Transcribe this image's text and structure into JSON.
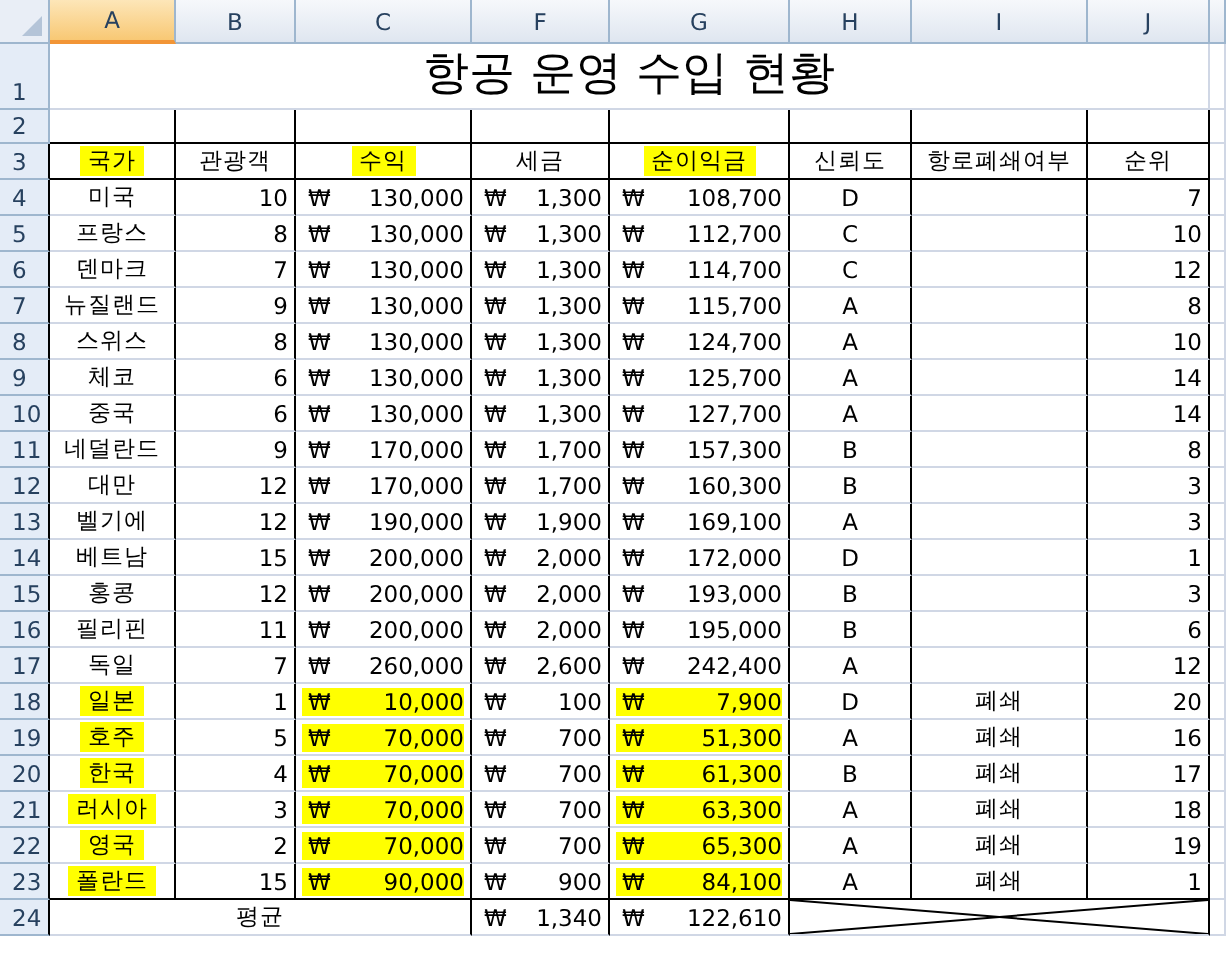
{
  "column_headers": [
    {
      "label": "A",
      "selected": true
    },
    {
      "label": "B",
      "selected": false
    },
    {
      "label": "C",
      "selected": false
    },
    {
      "label": "F",
      "selected": false
    },
    {
      "label": "G",
      "selected": false
    },
    {
      "label": "H",
      "selected": false
    },
    {
      "label": "I",
      "selected": false
    },
    {
      "label": "J",
      "selected": false
    }
  ],
  "title": {
    "row_number": "1",
    "text": "항공 운영 수입 현황"
  },
  "blank_row": {
    "row_number": "2"
  },
  "header_row": {
    "row_number": "3",
    "cells": [
      {
        "label": "국가",
        "highlighted": true
      },
      {
        "label": "관광객",
        "highlighted": false
      },
      {
        "label": "수익",
        "highlighted": true
      },
      {
        "label": "세금",
        "highlighted": false
      },
      {
        "label": "순이익금",
        "highlighted": true
      },
      {
        "label": "신뢰도",
        "highlighted": false
      },
      {
        "label": "항로폐쇄여부",
        "highlighted": false
      },
      {
        "label": "순위",
        "highlighted": false
      }
    ]
  },
  "rows": [
    {
      "row_number": "4",
      "country": "미국",
      "tourists": "10",
      "revenue": [
        "₩",
        "130,000"
      ],
      "tax": [
        "₩",
        "1,300"
      ],
      "net_income": [
        "₩",
        "108,700"
      ],
      "reliability": "D",
      "rank": "7",
      "highlighted": false
    },
    {
      "row_number": "5",
      "country": "프랑스",
      "tourists": "8",
      "revenue": [
        "₩",
        "130,000"
      ],
      "tax": [
        "₩",
        "1,300"
      ],
      "net_income": [
        "₩",
        "112,700"
      ],
      "reliability": "C",
      "rank": "10",
      "highlighted": false
    },
    {
      "row_number": "6",
      "country": "덴마크",
      "tourists": "7",
      "revenue": [
        "₩",
        "130,000"
      ],
      "tax": [
        "₩",
        "1,300"
      ],
      "net_income": [
        "₩",
        "114,700"
      ],
      "reliability": "C",
      "rank": "12",
      "highlighted": false
    },
    {
      "row_number": "7",
      "country": "뉴질랜드",
      "tourists": "9",
      "revenue": [
        "₩",
        "130,000"
      ],
      "tax": [
        "₩",
        "1,300"
      ],
      "net_income": [
        "₩",
        "115,700"
      ],
      "reliability": "A",
      "rank": "8",
      "highlighted": false
    },
    {
      "row_number": "8",
      "country": "스위스",
      "tourists": "8",
      "revenue": [
        "₩",
        "130,000"
      ],
      "tax": [
        "₩",
        "1,300"
      ],
      "net_income": [
        "₩",
        "124,700"
      ],
      "reliability": "A",
      "rank": "10",
      "highlighted": false
    },
    {
      "row_number": "9",
      "country": "체코",
      "tourists": "6",
      "revenue": [
        "₩",
        "130,000"
      ],
      "tax": [
        "₩",
        "1,300"
      ],
      "net_income": [
        "₩",
        "125,700"
      ],
      "reliability": "A",
      "rank": "14",
      "highlighted": false
    },
    {
      "row_number": "10",
      "country": "중국",
      "tourists": "6",
      "revenue": [
        "₩",
        "130,000"
      ],
      "tax": [
        "₩",
        "1,300"
      ],
      "net_income": [
        "₩",
        "127,700"
      ],
      "reliability": "A",
      "rank": "14",
      "highlighted": false
    },
    {
      "row_number": "11",
      "country": "네덜란드",
      "tourists": "9",
      "revenue": [
        "₩",
        "170,000"
      ],
      "tax": [
        "₩",
        "1,700"
      ],
      "net_income": [
        "₩",
        "157,300"
      ],
      "reliability": "B",
      "rank": "8",
      "highlighted": false
    },
    {
      "row_number": "12",
      "country": "대만",
      "tourists": "12",
      "revenue": [
        "₩",
        "170,000"
      ],
      "tax": [
        "₩",
        "1,700"
      ],
      "net_income": [
        "₩",
        "160,300"
      ],
      "reliability": "B",
      "rank": "3",
      "highlighted": false
    },
    {
      "row_number": "13",
      "country": "벨기에",
      "tourists": "12",
      "revenue": [
        "₩",
        "190,000"
      ],
      "tax": [
        "₩",
        "1,900"
      ],
      "net_income": [
        "₩",
        "169,100"
      ],
      "reliability": "A",
      "rank": "3",
      "highlighted": false
    },
    {
      "row_number": "14",
      "country": "베트남",
      "tourists": "15",
      "revenue": [
        "₩",
        "200,000"
      ],
      "tax": [
        "₩",
        "2,000"
      ],
      "net_income": [
        "₩",
        "172,000"
      ],
      "reliability": "D",
      "rank": "1",
      "highlighted": false
    },
    {
      "row_number": "15",
      "country": "홍콩",
      "tourists": "12",
      "revenue": [
        "₩",
        "200,000"
      ],
      "tax": [
        "₩",
        "2,000"
      ],
      "net_income": [
        "₩",
        "193,000"
      ],
      "reliability": "B",
      "rank": "3",
      "highlighted": false
    },
    {
      "row_number": "16",
      "country": "필리핀",
      "tourists": "11",
      "revenue": [
        "₩",
        "200,000"
      ],
      "tax": [
        "₩",
        "2,000"
      ],
      "net_income": [
        "₩",
        "195,000"
      ],
      "reliability": "B",
      "rank": "6",
      "highlighted": false
    },
    {
      "row_number": "17",
      "country": "독일",
      "tourists": "7",
      "revenue": [
        "₩",
        "260,000"
      ],
      "tax": [
        "₩",
        "2,600"
      ],
      "net_income": [
        "₩",
        "242,400"
      ],
      "reliability": "A",
      "rank": "12",
      "highlighted": false
    },
    {
      "row_number": "18",
      "country": "일본",
      "tourists": "1",
      "revenue": [
        "₩",
        "10,000"
      ],
      "tax": [
        "₩",
        "100"
      ],
      "net_income": [
        "₩",
        "7,900"
      ],
      "reliability": "D",
      "route_closed": "폐쇄",
      "rank": "20",
      "highlighted": true
    },
    {
      "row_number": "19",
      "country": "호주",
      "tourists": "5",
      "revenue": [
        "₩",
        "70,000"
      ],
      "tax": [
        "₩",
        "700"
      ],
      "net_income": [
        "₩",
        "51,300"
      ],
      "reliability": "A",
      "route_closed": "폐쇄",
      "rank": "16",
      "highlighted": true
    },
    {
      "row_number": "20",
      "country": "한국",
      "tourists": "4",
      "revenue": [
        "₩",
        "70,000"
      ],
      "tax": [
        "₩",
        "700"
      ],
      "net_income": [
        "₩",
        "61,300"
      ],
      "reliability": "B",
      "route_closed": "폐쇄",
      "rank": "17",
      "highlighted": true
    },
    {
      "row_number": "21",
      "country": "러시아",
      "tourists": "3",
      "revenue": [
        "₩",
        "70,000"
      ],
      "tax": [
        "₩",
        "700"
      ],
      "net_income": [
        "₩",
        "63,300"
      ],
      "reliability": "A",
      "route_closed": "폐쇄",
      "rank": "18",
      "highlighted": true
    },
    {
      "row_number": "22",
      "country": "영국",
      "tourists": "2",
      "revenue": [
        "₩",
        "70,000"
      ],
      "tax": [
        "₩",
        "700"
      ],
      "net_income": [
        "₩",
        "65,300"
      ],
      "reliability": "A",
      "route_closed": "폐쇄",
      "rank": "19",
      "highlighted": true
    },
    {
      "row_number": "23",
      "country": "폴란드",
      "tourists": "15",
      "revenue": [
        "₩",
        "90,000"
      ],
      "tax": [
        "₩",
        "900"
      ],
      "net_income": [
        "₩",
        "84,100"
      ],
      "reliability": "A",
      "route_closed": "폐쇄",
      "rank": "1",
      "highlighted": true
    }
  ],
  "summary_row": {
    "row_number": "24",
    "label": "평균",
    "tax": [
      "₩",
      "1,340"
    ],
    "net_income": [
      "₩",
      "122,610"
    ]
  }
}
